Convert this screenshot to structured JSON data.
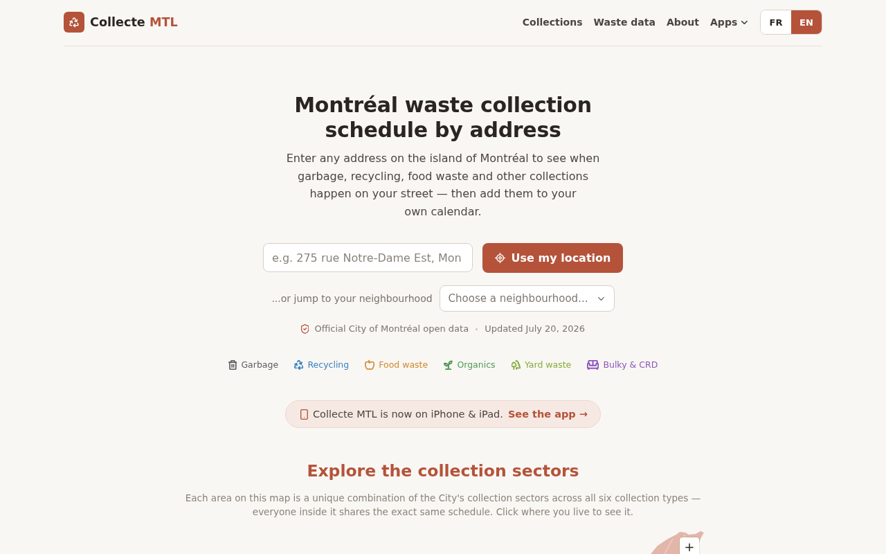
{
  "header": {
    "brand": {
      "name": "Collecte",
      "accent": "MTL"
    },
    "nav": [
      {
        "label": "Collections",
        "kind": "link"
      },
      {
        "label": "Waste data",
        "kind": "link"
      },
      {
        "label": "About",
        "kind": "link"
      },
      {
        "label": "Apps",
        "kind": "dropdown"
      }
    ],
    "languages": [
      {
        "label": "FR",
        "selected": false
      },
      {
        "label": "EN",
        "selected": true
      }
    ]
  },
  "hero": {
    "title": "Montréal waste collection schedule by address",
    "intro": "Enter any address on the island of Montréal to see when garbage, recycling, food waste and other collections happen on your street — then add them to your own calendar.",
    "address_field": {
      "placeholder": "e.g. 275 rue Notre-Dame Est, Mon"
    },
    "location_button": "Use my location",
    "neighbourhood": {
      "label": "...or jump to your neighbourhood",
      "placeholder": "Choose a neighbourhood..."
    },
    "source": "Official City of Montréal open data",
    "updated": "Updated July 20, 2026"
  },
  "legend": [
    {
      "kind": "garbage",
      "label": "Garbage",
      "color": "#5c5c62"
    },
    {
      "kind": "recycling",
      "label": "Recycling",
      "color": "#3a82c4"
    },
    {
      "kind": "food",
      "label": "Food waste",
      "color": "#cf8a2e"
    },
    {
      "kind": "organics",
      "label": "Organics",
      "color": "#4e9a55"
    },
    {
      "kind": "yard",
      "label": "Yard waste",
      "color": "#84ab3a"
    },
    {
      "kind": "bulky",
      "label": "Bulky & CRD",
      "color": "#8c55c2"
    }
  ],
  "app_banner": {
    "text": "Collecte MTL is now on iPhone & iPad.",
    "link": "See the app →"
  },
  "sectors": {
    "title": "Explore the collection sectors",
    "description": "Each area on this map is a unique combination of the City's collection sectors across all six collection types — everyone inside it shares the exact same schedule. Click where you live to see it.",
    "map": {
      "zoom_in": "+"
    }
  }
}
